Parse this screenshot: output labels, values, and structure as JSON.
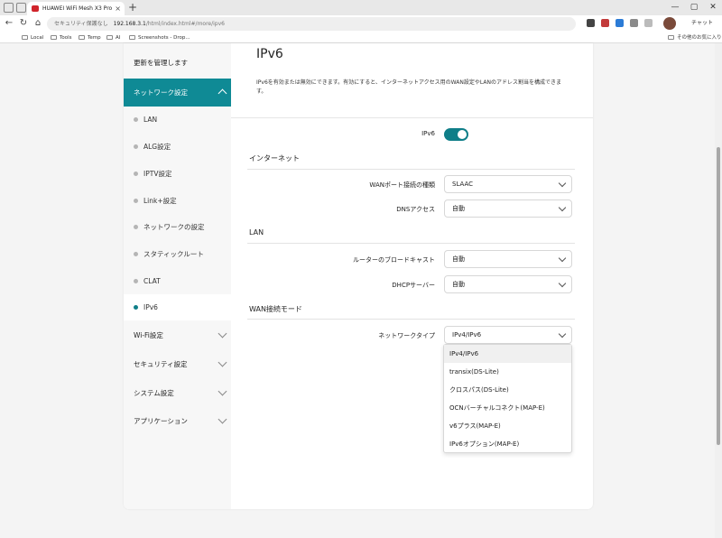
{
  "browser": {
    "tab_title": "HUAWEI WiFi Mesh X3 Pro",
    "tab_close": "×",
    "new_tab": "+",
    "insecure_label": "セキュリティ保護なし",
    "url_host": "192.168.3.1",
    "url_path": "/html/index.html#/more/ipv6",
    "chat_label": "チャット",
    "window_minimize": "—",
    "window_maximize": "▢",
    "window_close": "✕",
    "back": "←",
    "reload": "↻",
    "home": "⌂"
  },
  "bookmarks": {
    "items": [
      "Local",
      "Tools",
      "Temp",
      "AI",
      "Screenshots - Drop..."
    ],
    "other": "その他のお気に入り"
  },
  "sidebar": {
    "top_item": "更新を管理します",
    "active_group": "ネットワーク設定",
    "items": [
      "LAN",
      "ALG設定",
      "IPTV設定",
      "Link+設定",
      "ネットワークの設定",
      "スタティックルート",
      "CLAT",
      "IPv6"
    ],
    "active_item": "IPv6",
    "groups": [
      "Wi-Fi設定",
      "セキュリティ設定",
      "システム設定",
      "アプリケーション"
    ]
  },
  "main": {
    "title": "IPv6",
    "description": "IPv6を有効または無効にできます。有効にすると、インターネットアクセス用のWAN設定やLANのアドレス割当を構成できます。",
    "ipv6_label": "IPv6",
    "ipv6_enabled": true,
    "internet_section": "インターネット",
    "wan_type_label": "WANポート接続の種類",
    "wan_type_value": "SLAAC",
    "dns_label": "DNSアクセス",
    "dns_value": "自動",
    "lan_section": "LAN",
    "router_broadcast_label": "ルーターのブロードキャスト",
    "router_broadcast_value": "自動",
    "dhcp_label": "DHCPサーバー",
    "dhcp_value": "自動",
    "wan_mode_section": "WAN接続モード",
    "network_type_label": "ネットワークタイプ",
    "network_type_value": "IPv4/IPv6",
    "network_type_options": [
      "IPv4/IPv6",
      "transix(DS-Lite)",
      "クロスパス(DS-Lite)",
      "OCNバーチャルコネクト(MAP-E)",
      "v6プラス(MAP-E)",
      "IPv6オプション(MAP-E)"
    ]
  },
  "colors": {
    "accent": "#0f8a95",
    "toggle_on": "#0f7e88"
  }
}
